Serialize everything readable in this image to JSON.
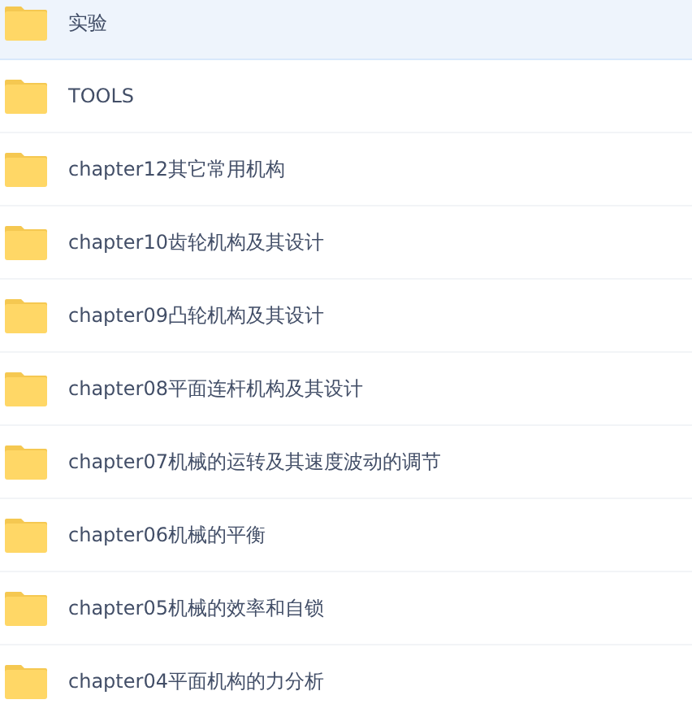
{
  "folders": [
    {
      "name": "实验",
      "selected": true
    },
    {
      "name": "TOOLS",
      "selected": false
    },
    {
      "name": "chapter12其它常用机构",
      "selected": false
    },
    {
      "name": "chapter10齿轮机构及其设计",
      "selected": false
    },
    {
      "name": "chapter09凸轮机构及其设计",
      "selected": false
    },
    {
      "name": "chapter08平面连杆机构及其设计",
      "selected": false
    },
    {
      "name": "chapter07机械的运转及其速度波动的调节",
      "selected": false
    },
    {
      "name": "chapter06机械的平衡",
      "selected": false
    },
    {
      "name": "chapter05机械的效率和自锁",
      "selected": false
    },
    {
      "name": "chapter04平面机构的力分析",
      "selected": false
    }
  ]
}
